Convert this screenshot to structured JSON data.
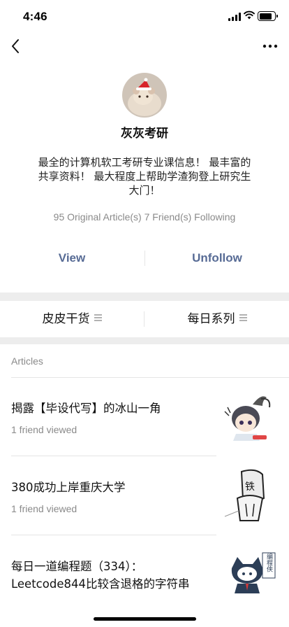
{
  "status_bar": {
    "time": "4:46"
  },
  "nav": {
    "back_icon": "chevron-left-icon",
    "more_icon": "more-dots-icon"
  },
  "profile": {
    "name": "灰灰考研",
    "description": "最全的计算机软工考研专业课信息！ 最丰富的共享资料！ 最大程度上帮助学渣狗登上研究生大门！",
    "stats": "95 Original Article(s)  7 Friend(s) Following"
  },
  "actions": {
    "view_label": "View",
    "unfollow_label": "Unfollow",
    "color": "#576b95"
  },
  "menu": [
    {
      "label": "皮皮干货"
    },
    {
      "label": "每日系列"
    }
  ],
  "articles_section": {
    "label": "Articles"
  },
  "articles": [
    {
      "title": "揭露【毕设代写】的冰山一角",
      "meta": "1 friend viewed"
    },
    {
      "title": "380成功上岸重庆大学",
      "meta": "1 friend viewed"
    },
    {
      "title": "每日一道编程题（334）：Leetcode844比较含退格的字符串",
      "meta": ""
    }
  ],
  "thumb_texts": {
    "article_2_sign": "铁",
    "article_3_badge": "编程侠"
  },
  "colors": {
    "background_band": "#ededed",
    "secondary_text": "#8a8a8a",
    "link": "#576b95"
  }
}
